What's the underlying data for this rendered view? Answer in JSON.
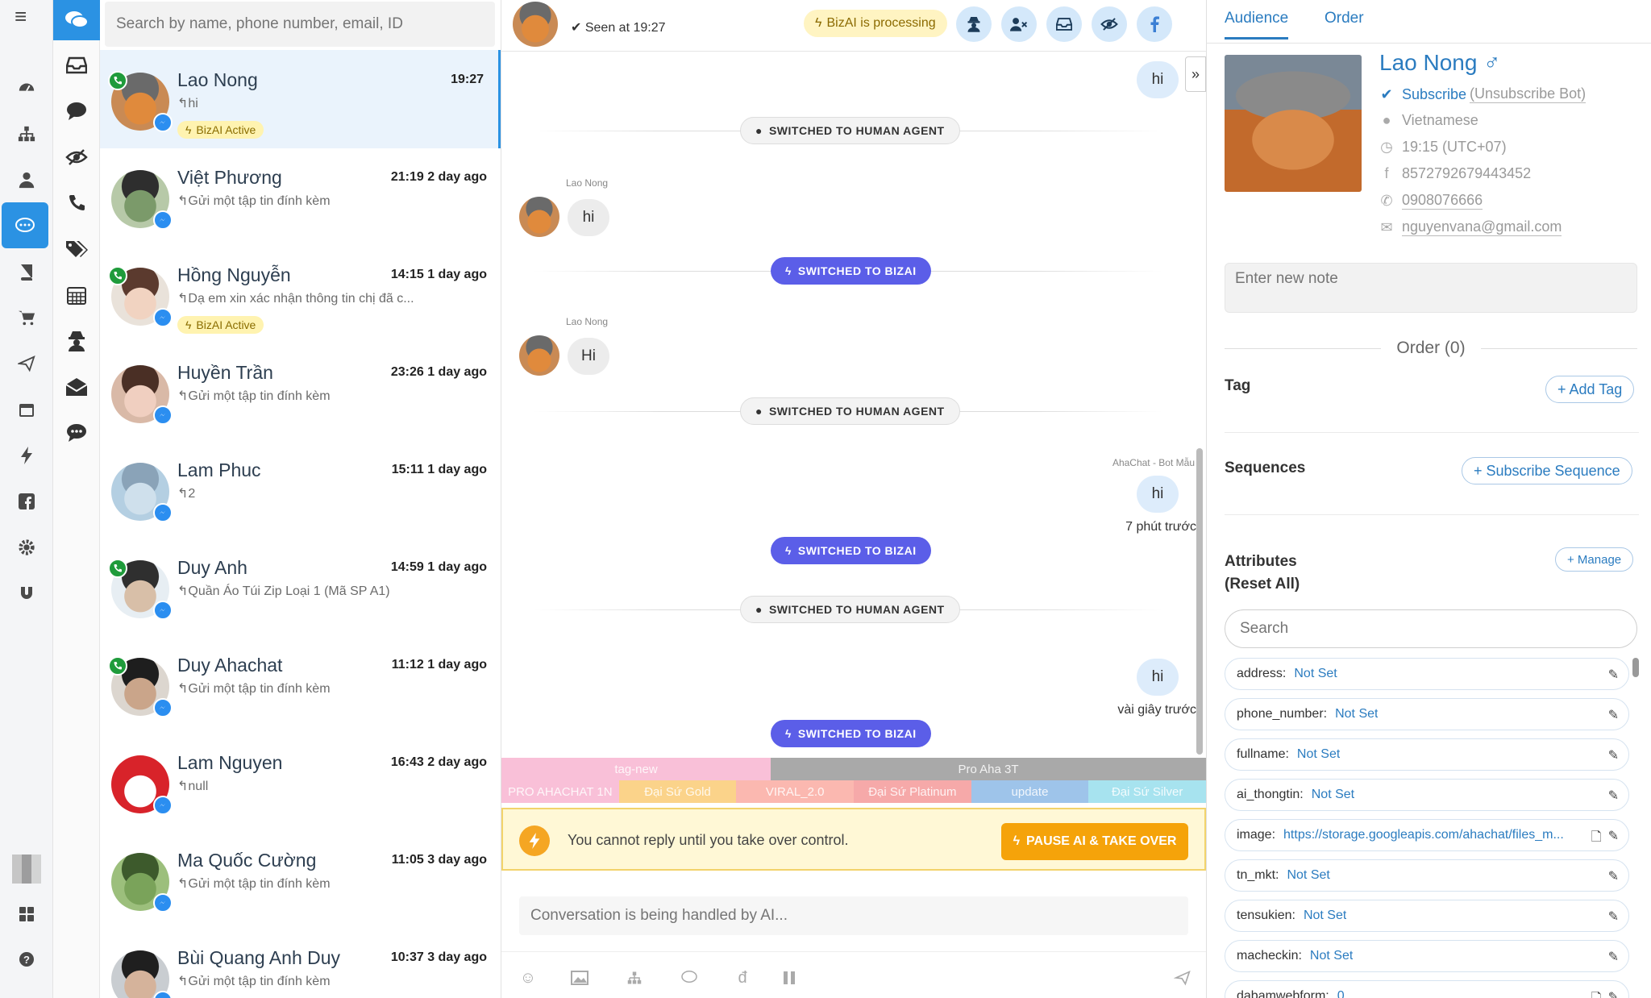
{
  "search": {
    "placeholder": "Search by name, phone number, email, ID"
  },
  "conversations": [
    {
      "name": "Lao Nong",
      "time": "19:27",
      "preview": "hi",
      "bizai": "BizAI Active",
      "phone": true
    },
    {
      "name": "Việt Phương",
      "time": "21:19 2 day ago",
      "preview": "Gửi một tập tin đính kèm",
      "bizai": "",
      "phone": false
    },
    {
      "name": "Hồng Nguyễn",
      "time": "14:15 1 day ago",
      "preview": "Dạ em xin xác nhận thông tin chị đã c...",
      "bizai": "BizAI Active",
      "phone": true
    },
    {
      "name": "Huyền Trần",
      "time": "23:26 1 day ago",
      "preview": "Gửi một tập tin đính kèm",
      "bizai": "",
      "phone": false
    },
    {
      "name": "Lam Phuc",
      "time": "15:11 1 day ago",
      "preview": "2",
      "bizai": "",
      "phone": false
    },
    {
      "name": "Duy Anh",
      "time": "14:59 1 day ago",
      "preview": "Quần Áo Túi Zip Loại 1 (Mã SP A1)",
      "bizai": "",
      "phone": true
    },
    {
      "name": "Duy Ahachat",
      "time": "11:12 1 day ago",
      "preview": "Gửi một tập tin đính kèm",
      "bizai": "",
      "phone": true
    },
    {
      "name": "Lam Nguyen",
      "time": "16:43 2 day ago",
      "preview": "null",
      "bizai": "",
      "phone": false
    },
    {
      "name": "Ma Quốc Cường",
      "time": "11:05 3 day ago",
      "preview": "Gửi một tập tin đính kèm",
      "bizai": "",
      "phone": false
    },
    {
      "name": "Bùi Quang Anh Duy",
      "time": "10:37 3 day ago",
      "preview": "Gửi một tập tin đính kèm",
      "bizai": "",
      "phone": false
    }
  ],
  "chat": {
    "seen": "Seen at 19:27",
    "processing": "BizAI is processing",
    "messages": {
      "out1": "hi",
      "pill1": "SWITCHED TO HUMAN AGENT",
      "sender1": "Lao Nong",
      "in1": "hi",
      "pill2": "SWITCHED TO BIZAI",
      "sender2": "Lao Nong",
      "in2": "Hi",
      "pill3": "SWITCHED TO HUMAN AGENT",
      "sender3": "AhaChat - Bot Mẫu",
      "out2": "hi",
      "out2_time": "7 phút trước",
      "pill4": "SWITCHED TO BIZAI",
      "pill5": "SWITCHED TO HUMAN AGENT",
      "out3": "hi",
      "out3_time": "vài giây trước",
      "pill6": "SWITCHED TO BIZAI"
    },
    "tags_row1": [
      {
        "label": "tag-new",
        "color": "#f9c0d8"
      },
      {
        "label": "Pro Aha 3T",
        "color": "#a9a9a9"
      }
    ],
    "tags_row2": [
      {
        "label": "PRO AHACHAT 1N",
        "color": "#f9c0d8"
      },
      {
        "label": "Đại Sứ Gold",
        "color": "#fbd38a"
      },
      {
        "label": "VIRAL_2.0",
        "color": "#fbb8b0"
      },
      {
        "label": "Đại Sứ Platinum",
        "color": "#f6a9a9"
      },
      {
        "label": "update",
        "color": "#9ec4ea"
      },
      {
        "label": "Đại Sứ Silver",
        "color": "#a7e3ef"
      }
    ],
    "notice": "You cannot reply until you take over control.",
    "takeover": "PAUSE AI & TAKE OVER",
    "composer_placeholder": "Conversation is being handled by AI..."
  },
  "panel": {
    "tabs": [
      "Audience",
      "Order"
    ],
    "name": "Lao Nong",
    "gender_symbol": "♂",
    "subscribe": "Subscribe",
    "unsubscribe": "(Unsubscribe Bot)",
    "language": "Vietnamese",
    "timezone": "19:15 (UTC+07)",
    "facebook_id": "8572792679443452",
    "phone": "0908076666",
    "email": "nguyenvana@gmail.com",
    "note_placeholder": "Enter new note",
    "order": "Order (0)",
    "tag_label": "Tag",
    "add_tag": "+ Add Tag",
    "sequences_label": "Sequences",
    "subscribe_sequence": "+ Subscribe Sequence",
    "attributes_label": "Attributes",
    "reset_all": "(Reset All)",
    "manage": "+ Manage",
    "attr_search_placeholder": "Search",
    "attributes": [
      {
        "key": "address:",
        "value": "Not Set"
      },
      {
        "key": "phone_number:",
        "value": "Not Set"
      },
      {
        "key": "fullname:",
        "value": "Not Set"
      },
      {
        "key": "ai_thongtin:",
        "value": "Not Set"
      },
      {
        "key": "image:",
        "value": "https://storage.googleapis.com/ahachat/files_m..."
      },
      {
        "key": "tn_mkt:",
        "value": "Not Set"
      },
      {
        "key": "tensukien:",
        "value": "Not Set"
      },
      {
        "key": "macheckin:",
        "value": "Not Set"
      },
      {
        "key": "dabamwebform:",
        "value": "0"
      }
    ]
  },
  "colors": {
    "primary": "#2b92e3",
    "bizai": "#5b5ee8",
    "warning": "#f5a30a"
  }
}
